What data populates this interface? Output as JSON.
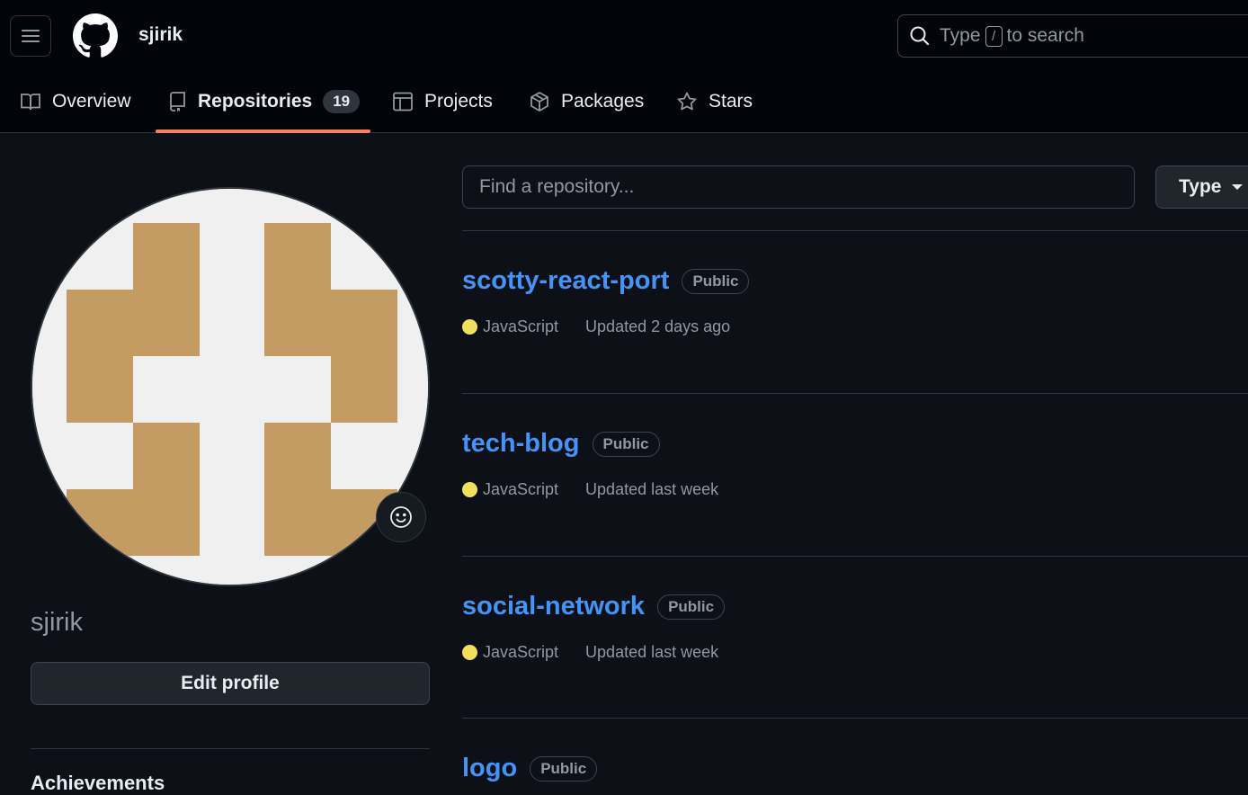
{
  "header": {
    "username": "sjirik",
    "search": {
      "prefix": "Type",
      "key": "/",
      "suffix": "to search"
    }
  },
  "tabs": [
    {
      "label": "Overview",
      "icon": "book-icon"
    },
    {
      "label": "Repositories",
      "icon": "repo-icon",
      "count": "19",
      "active": true
    },
    {
      "label": "Projects",
      "icon": "table-icon"
    },
    {
      "label": "Packages",
      "icon": "package-icon"
    },
    {
      "label": "Stars",
      "icon": "star-icon"
    }
  ],
  "profile": {
    "name": "sjirik",
    "edit_label": "Edit profile",
    "achievements_label": "Achievements",
    "avatar_color": "#c49b63"
  },
  "repo_filter": {
    "placeholder": "Find a repository...",
    "type_label": "Type"
  },
  "repos": [
    {
      "name": "scotty-react-port",
      "visibility": "Public",
      "language": "JavaScript",
      "language_color": "#f1e05a",
      "updated": "Updated 2 days ago"
    },
    {
      "name": "tech-blog",
      "visibility": "Public",
      "language": "JavaScript",
      "language_color": "#f1e05a",
      "updated": "Updated last week"
    },
    {
      "name": "social-network",
      "visibility": "Public",
      "language": "JavaScript",
      "language_color": "#f1e05a",
      "updated": "Updated last week"
    },
    {
      "name": "logo",
      "visibility": "Public"
    }
  ]
}
